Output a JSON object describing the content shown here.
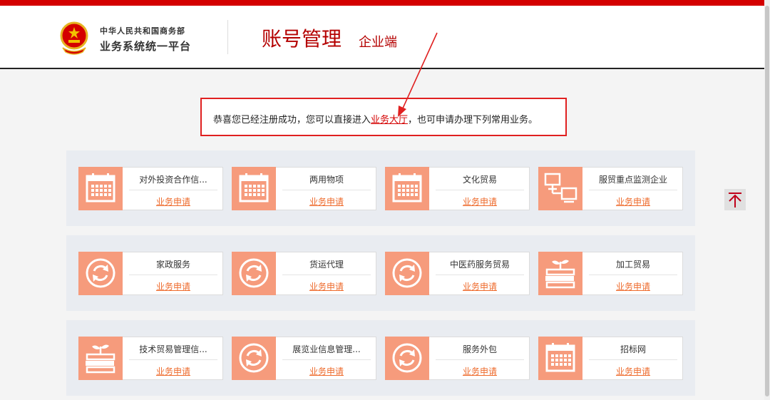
{
  "header": {
    "org_line1": "中华人民共和国商务部",
    "org_line2": "业务系统统一平台",
    "title": "账号管理",
    "subtitle": "企业端"
  },
  "notice": {
    "text_before": "恭喜您已经注册成功，您可以直接进入",
    "link": "业务大厅",
    "text_after": "，也可申请办理下列常用业务。"
  },
  "groups": [
    {
      "cards": [
        {
          "name": "对外投资合作信...",
          "link": "业务申请",
          "icon": "calendar-icon"
        },
        {
          "name": "两用物项",
          "link": "业务申请",
          "icon": "calendar-icon"
        },
        {
          "name": "文化贸易",
          "link": "业务申请",
          "icon": "calendar-icon"
        },
        {
          "name": "服贸重点监测企业",
          "link": "业务申请",
          "icon": "network-icon"
        }
      ]
    },
    {
      "cards": [
        {
          "name": "家政服务",
          "link": "业务申请",
          "icon": "refresh-icon"
        },
        {
          "name": "货运代理",
          "link": "业务申请",
          "icon": "refresh-icon"
        },
        {
          "name": "中医药服务贸易",
          "link": "业务申请",
          "icon": "refresh-icon"
        },
        {
          "name": "加工贸易",
          "link": "业务申请",
          "icon": "books-plant-icon"
        }
      ]
    },
    {
      "cards": [
        {
          "name": "技术贸易管理信...",
          "link": "业务申请",
          "icon": "books-plant-icon"
        },
        {
          "name": "展览业信息管理...",
          "link": "业务申请",
          "icon": "refresh-icon"
        },
        {
          "name": "服务外包",
          "link": "业务申请",
          "icon": "refresh-icon"
        },
        {
          "name": "招标网",
          "link": "业务申请",
          "icon": "calendar-icon"
        }
      ]
    }
  ],
  "colors": {
    "brand_red": "#d40000",
    "icon_bg": "#f69b7c",
    "link_orange": "#ee6a2b",
    "group_bg": "#e9ecf1"
  }
}
